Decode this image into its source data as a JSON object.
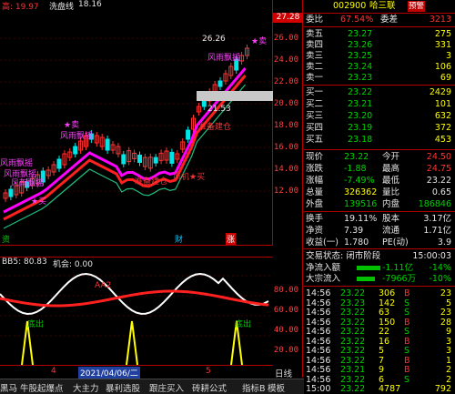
{
  "header": {
    "title_fragment": "高: 19.97",
    "line_label": "洗盘线",
    "line_value": "18.16",
    "price_box": "27.28"
  },
  "yaxis": {
    "ticks": [
      "26.00",
      "24.00",
      "22.00",
      "20.00",
      "18.00",
      "16.00",
      "14.00",
      "12.00"
    ],
    "ind_ticks": [
      "80.00",
      "60.00",
      "40.00",
      "20.00"
    ]
  },
  "chart": {
    "peak_label": "26.26",
    "low_label": "21.53",
    "annotations": [
      {
        "text": "风雨飘摇"
      },
      {
        "text": "风雨飘摇"
      },
      {
        "text": "风雨飘摇"
      },
      {
        "text": "风雨飘摇"
      },
      {
        "text": "风雨飘摇"
      },
      {
        "text": "卖"
      },
      {
        "text": "卖"
      },
      {
        "text": "买"
      },
      {
        "text": "风机★买"
      },
      {
        "text": "准备建仓"
      },
      {
        "text": "准备建仓"
      }
    ],
    "bottom_labels": [
      "资",
      "财",
      "涨"
    ]
  },
  "indicator": {
    "title": "BB5: 80.83",
    "chance_label": "机会: 0.00",
    "line_label": "AA2",
    "signals": [
      "底出",
      "底出"
    ]
  },
  "timebar": {
    "left_label": "4",
    "date_label": "2021/04/06/二",
    "right_label": "5"
  },
  "tabs": [
    "黑马",
    "牛股起爆点",
    "大主力",
    "暴利选股",
    "跟庄买入",
    "砖耕公式",
    "指标B",
    "模板",
    "日线"
  ],
  "panel": {
    "stock_code": "002900",
    "stock_name": "哈三联",
    "badge": "预警",
    "weibi_label": "委比",
    "weibi_value": "67.54%",
    "weicha_label": "委差",
    "weicha_value": "3213",
    "asks": [
      {
        "label": "卖五",
        "price": "23.27",
        "vol": "275"
      },
      {
        "label": "卖四",
        "price": "23.26",
        "vol": "331"
      },
      {
        "label": "卖三",
        "price": "23.25",
        "vol": "3"
      },
      {
        "label": "卖二",
        "price": "23.24",
        "vol": "106"
      },
      {
        "label": "卖一",
        "price": "23.23",
        "vol": "69"
      }
    ],
    "bids": [
      {
        "label": "买一",
        "price": "23.22",
        "vol": "2429"
      },
      {
        "label": "买二",
        "price": "23.21",
        "vol": "101"
      },
      {
        "label": "买三",
        "price": "23.20",
        "vol": "632"
      },
      {
        "label": "买四",
        "price": "23.19",
        "vol": "372"
      },
      {
        "label": "买五",
        "price": "23.18",
        "vol": "453"
      }
    ],
    "stats": [
      {
        "l1": "现价",
        "v1": "23.22",
        "l2": "今开",
        "v2": "24.50"
      },
      {
        "l1": "涨跌",
        "v1": "-1.88",
        "l2": "最高",
        "v2": "24.75"
      },
      {
        "l1": "涨幅",
        "v1": "-7.49%",
        "l2": "最低",
        "v2": "23.22"
      },
      {
        "l1": "总量",
        "v1": "326362",
        "l2": "量比",
        "v2": "0.65"
      },
      {
        "l1": "外盘",
        "v1": "139516",
        "l2": "内盘",
        "v2": "186846"
      }
    ],
    "stats2": [
      {
        "l1": "换手",
        "v1": "19.11%",
        "l2": "股本",
        "v2": "3.17亿"
      },
      {
        "l1": "净资",
        "v1": "7.39",
        "l2": "流通",
        "v2": "1.71亿"
      },
      {
        "l1": "收益(一)",
        "v1": "1.780",
        "l2": "PE(动)",
        "v2": "3.9"
      }
    ],
    "status_label": "交易状态: 闭市阶段",
    "status_time": "15:00:03",
    "flows": [
      {
        "label": "净流入额",
        "value": "-1.11亿",
        "pct": "-14%"
      },
      {
        "label": "大宗流入",
        "value": "-7966万",
        "pct": "-10%"
      }
    ],
    "ticks": [
      {
        "time": "14:56",
        "price": "23.22",
        "vol": "306",
        "side": "B",
        "n": "23"
      },
      {
        "time": "14:56",
        "price": "23.23",
        "vol": "142",
        "side": "S",
        "n": "5"
      },
      {
        "time": "14:56",
        "price": "23.22",
        "vol": "63",
        "side": "S",
        "n": "23"
      },
      {
        "time": "14:56",
        "price": "23.22",
        "vol": "150",
        "side": "B",
        "n": "28"
      },
      {
        "time": "14:56",
        "price": "23.22",
        "vol": "22",
        "side": "S",
        "n": "9"
      },
      {
        "time": "14:56",
        "price": "23.22",
        "vol": "16",
        "side": "B",
        "n": "3"
      },
      {
        "time": "14:56",
        "price": "23.22",
        "vol": "5",
        "side": "S",
        "n": "3"
      },
      {
        "time": "14:56",
        "price": "23.22",
        "vol": "7",
        "side": "B",
        "n": "1"
      },
      {
        "time": "14:56",
        "price": "23.21",
        "vol": "9",
        "side": "B",
        "n": "2"
      },
      {
        "time": "14:56",
        "price": "23.22",
        "vol": "6",
        "side": "S",
        "n": "2"
      },
      {
        "time": "15:00",
        "price": "23.22",
        "vol": "4787",
        "side": "",
        "n": "792"
      }
    ]
  },
  "colors": {
    "up": "#ff3232",
    "down": "#00d200",
    "axis": "#b00000"
  }
}
